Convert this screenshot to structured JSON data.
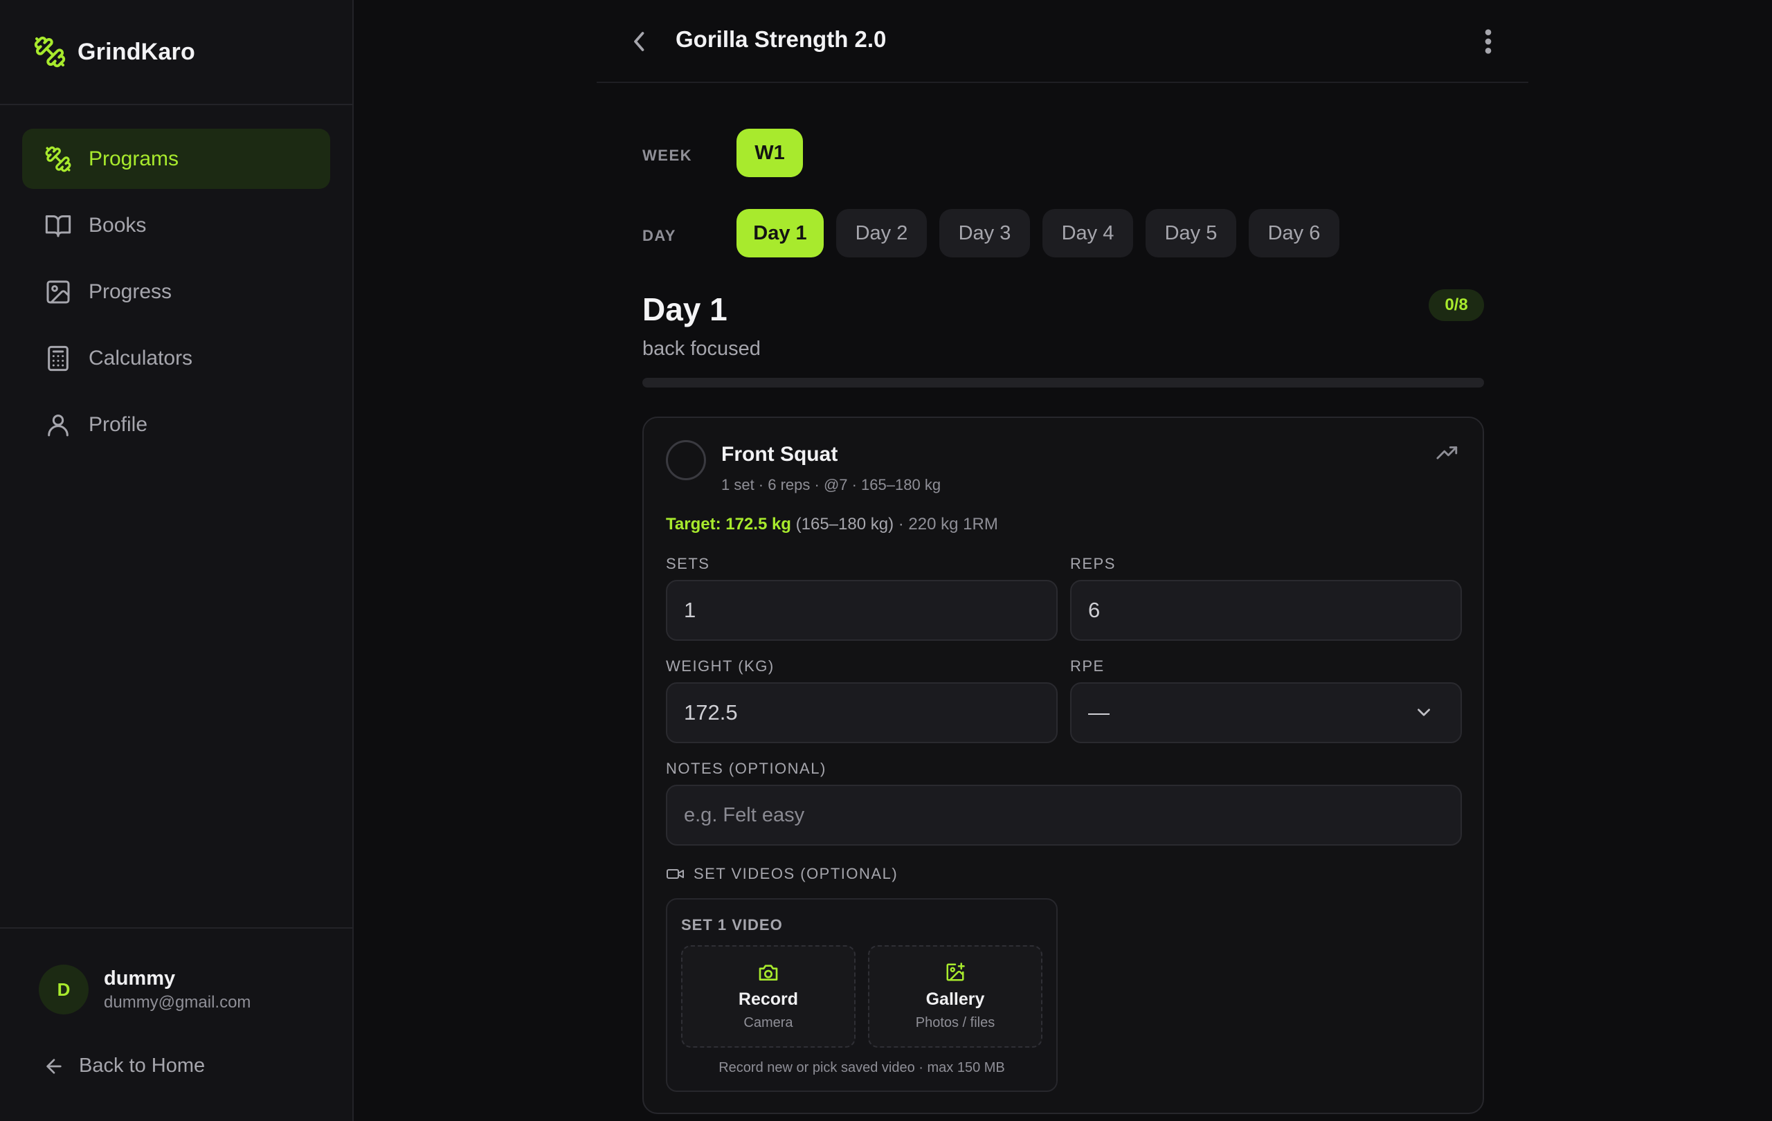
{
  "brand": {
    "name": "GrindKaro",
    "accent": "#a8ea2d"
  },
  "sidebar": {
    "items": [
      {
        "label": "Programs",
        "icon": "dumbbell-icon",
        "active": true
      },
      {
        "label": "Books",
        "icon": "book-icon",
        "active": false
      },
      {
        "label": "Progress",
        "icon": "image-icon",
        "active": false
      },
      {
        "label": "Calculators",
        "icon": "calculator-icon",
        "active": false
      },
      {
        "label": "Profile",
        "icon": "user-icon",
        "active": false
      }
    ],
    "user": {
      "initial": "D",
      "name": "dummy",
      "email": "dummy@gmail.com"
    },
    "back_home": "Back to Home"
  },
  "header": {
    "title": "Gorilla Strength 2.0"
  },
  "week": {
    "label": "WEEK",
    "options": [
      "W1"
    ],
    "selected": "W1"
  },
  "day": {
    "label": "DAY",
    "options": [
      "Day 1",
      "Day 2",
      "Day 3",
      "Day 4",
      "Day 5",
      "Day 6"
    ],
    "selected": "Day 1"
  },
  "session": {
    "title": "Day 1",
    "subtitle": "back focused",
    "completed_count": "0/8",
    "progress_fraction": 0
  },
  "exercise": {
    "name": "Front Squat",
    "meta": "1 set · 6 reps · @7 · 165–180 kg",
    "target": {
      "main": "Target: 172.5 kg",
      "range": "(165–180 kg)",
      "one_rm": "· 220 kg 1RM"
    },
    "fields": {
      "sets": {
        "label": "SETS",
        "value": "1"
      },
      "reps": {
        "label": "REPS",
        "value": "6"
      },
      "weight": {
        "label": "WEIGHT (KG)",
        "value": "172.5"
      },
      "rpe": {
        "label": "RPE",
        "value": "—"
      },
      "notes": {
        "label": "NOTES (OPTIONAL)",
        "placeholder": "e.g. Felt easy"
      }
    },
    "videos": {
      "label": "SET VIDEOS (OPTIONAL)",
      "set_title": "SET 1 VIDEO",
      "record": {
        "title": "Record",
        "subtitle": "Camera"
      },
      "gallery": {
        "title": "Gallery",
        "subtitle": "Photos / files"
      },
      "note": "Record new or pick saved video · max 150 MB"
    }
  }
}
